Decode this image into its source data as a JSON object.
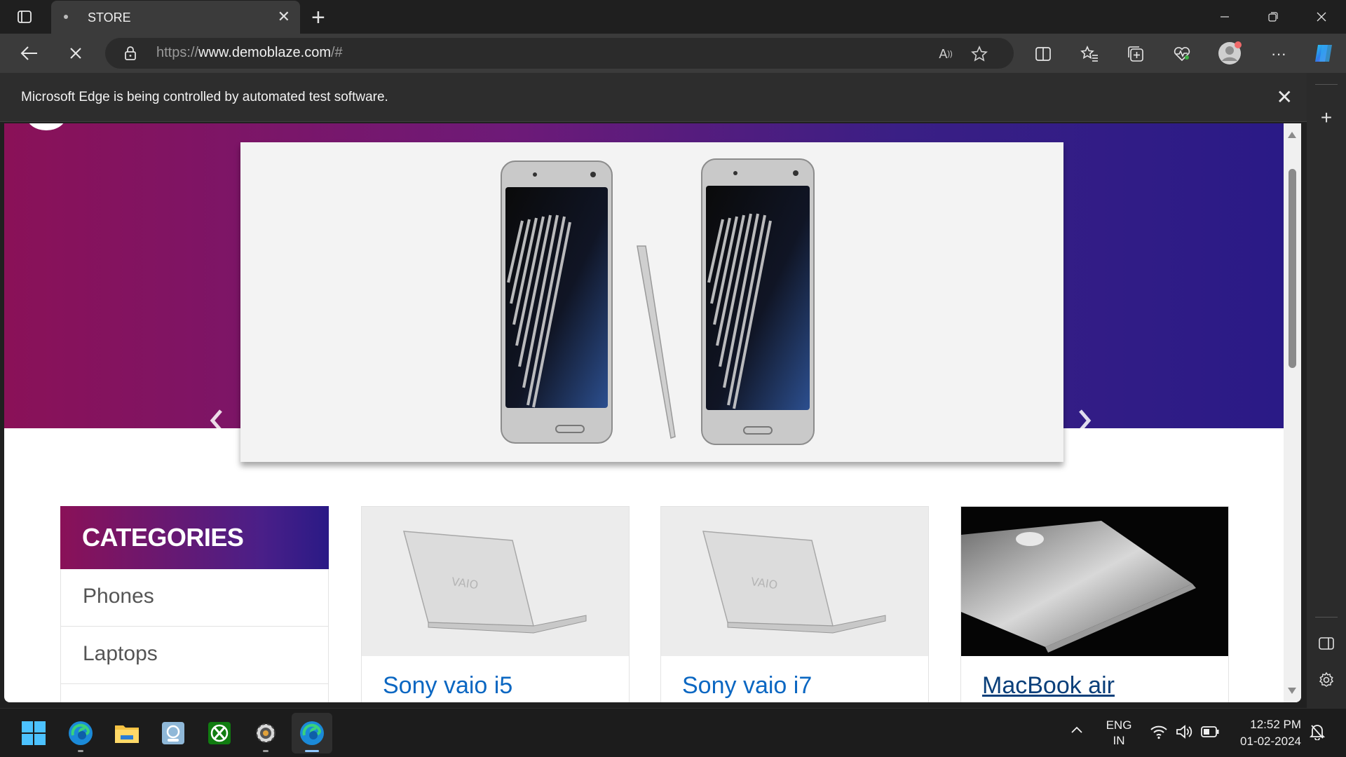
{
  "browser": {
    "tab_title": "STORE",
    "url_prefix": "https://",
    "url_host": "www.demoblaze.com",
    "url_path": "/#",
    "info_message": "Microsoft Edge is being controlled by automated test software."
  },
  "store": {
    "categories_title": "CATEGORIES",
    "categories": [
      {
        "label": "Phones"
      },
      {
        "label": "Laptops"
      }
    ],
    "carousel": {
      "slides": 3,
      "active_slide": 1
    },
    "products": [
      {
        "name": "Sony vaio i5",
        "image": "laptop-silver"
      },
      {
        "name": "Sony vaio i7",
        "image": "laptop-silver"
      },
      {
        "name": "MacBook air",
        "image": "laptop-dark"
      }
    ]
  },
  "taskbar": {
    "language_line1": "ENG",
    "language_line2": "IN",
    "time": "12:52 PM",
    "date": "01-02-2024"
  },
  "colors": {
    "hero_start": "#8a1158",
    "hero_end": "#2a1a86",
    "link": "#0b67c2"
  }
}
